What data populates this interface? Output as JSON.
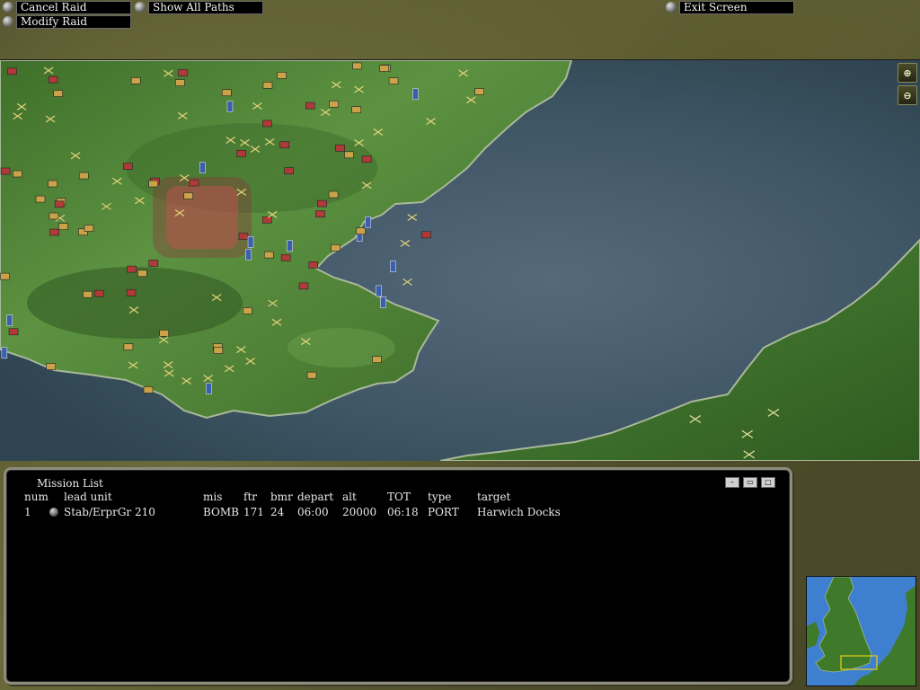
{
  "toolbar": {
    "cancel_raid": "Cancel Raid",
    "show_all_paths": "Show All Paths",
    "modify_raid": "Modify Raid",
    "exit_screen": "Exit Screen"
  },
  "map": {
    "zoom_in_icon": "zoom-in-icon",
    "zoom_out_icon": "zoom-out-icon"
  },
  "mission_list": {
    "title": "Mission List",
    "columns": [
      "num",
      "lead unit",
      "mis",
      "ftr",
      "bmr",
      "depart",
      "alt",
      "TOT",
      "type",
      "target"
    ],
    "rows": [
      {
        "num": "1",
        "lead_unit": "Stab/ErprGr 210",
        "mis": "BOMB",
        "ftr": "171",
        "bmr": "24",
        "depart": "06:00",
        "alt": "20000",
        "tot": "06:18",
        "type": "PORT",
        "target": "Harwich Docks"
      }
    ]
  },
  "colors": {
    "sea": "#4f6470",
    "land": "#4f8a3a",
    "panel_bg": "#000000",
    "minimap_sea": "#3f7fd0",
    "minimap_land": "#3f7a2a",
    "viewport_box": "#e6d21a"
  }
}
